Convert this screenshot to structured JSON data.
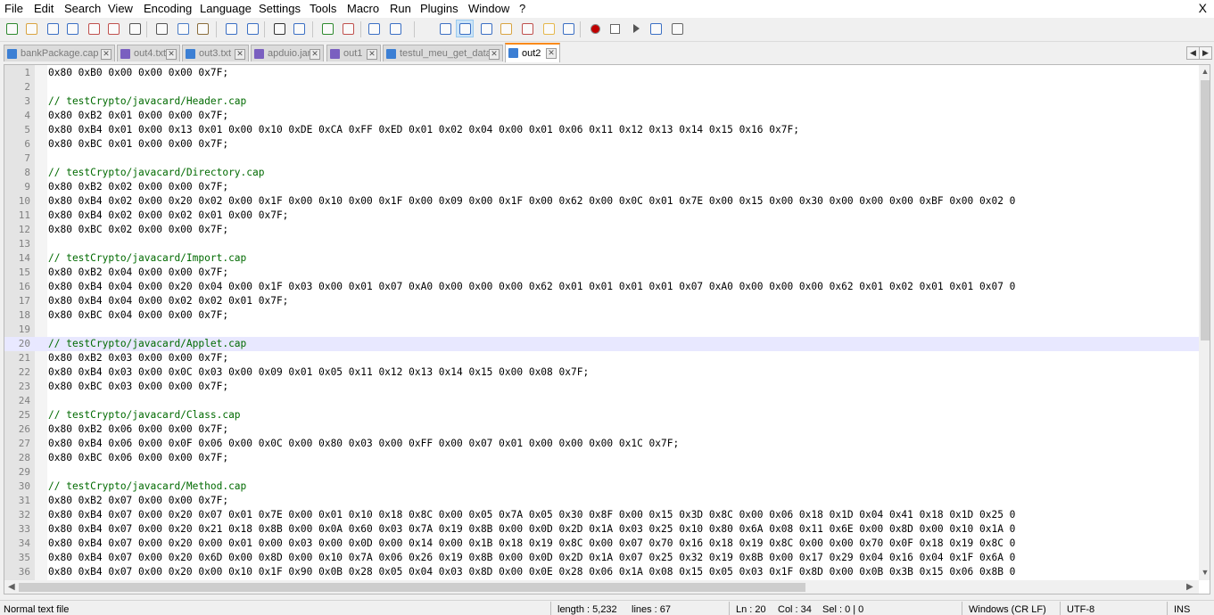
{
  "menu": [
    "File",
    "Edit",
    "Search",
    "View",
    "Encoding",
    "Language",
    "Settings",
    "Tools",
    "Macro",
    "Run",
    "Plugins",
    "Window",
    "?"
  ],
  "close_label": "X",
  "toolbar_icons": [
    "new-file-icon",
    "open-file-icon",
    "save-icon",
    "save-all-icon",
    "close-icon",
    "close-all-icon",
    "print-icon",
    "cut-icon",
    "copy-icon",
    "paste-icon",
    "undo-icon",
    "redo-icon",
    "find-icon",
    "replace-icon",
    "zoom-in-icon",
    "zoom-out-icon",
    "sync-vertical-icon",
    "sync-horizontal-icon",
    "word-wrap-icon",
    "show-all-chars-icon",
    "indent-guide-icon",
    "document-map-icon",
    "function-list-icon",
    "folder-workspace-icon",
    "monitoring-icon",
    "record-macro-icon",
    "stop-macro-icon",
    "play-macro-icon",
    "run-macro-multiple-icon",
    "save-macro-icon"
  ],
  "tabs": [
    {
      "label": "bankPackage.cap",
      "active": false,
      "modified": false
    },
    {
      "label": "out4.txt",
      "active": false,
      "modified": true
    },
    {
      "label": "out3.txt",
      "active": false,
      "modified": false
    },
    {
      "label": "apduio.jar",
      "active": false,
      "modified": true
    },
    {
      "label": "out1",
      "active": false,
      "modified": true
    },
    {
      "label": "testul_meu_get_data",
      "active": false,
      "modified": false
    },
    {
      "label": "out2",
      "active": true,
      "modified": false
    }
  ],
  "editor": {
    "current_line": 20,
    "lines": [
      "0x80 0xB0 0x00 0x00 0x00 0x7F;",
      "",
      "// testCrypto/javacard/Header.cap",
      "0x80 0xB2 0x01 0x00 0x00 0x7F;",
      "0x80 0xB4 0x01 0x00 0x13 0x01 0x00 0x10 0xDE 0xCA 0xFF 0xED 0x01 0x02 0x04 0x00 0x01 0x06 0x11 0x12 0x13 0x14 0x15 0x16 0x7F;",
      "0x80 0xBC 0x01 0x00 0x00 0x7F;",
      "",
      "// testCrypto/javacard/Directory.cap",
      "0x80 0xB2 0x02 0x00 0x00 0x7F;",
      "0x80 0xB4 0x02 0x00 0x20 0x02 0x00 0x1F 0x00 0x10 0x00 0x1F 0x00 0x09 0x00 0x1F 0x00 0x62 0x00 0x0C 0x01 0x7E 0x00 0x15 0x00 0x30 0x00 0x00 0x00 0xBF 0x00 0x02 0",
      "0x80 0xB4 0x02 0x00 0x02 0x01 0x00 0x7F;",
      "0x80 0xBC 0x02 0x00 0x00 0x7F;",
      "",
      "// testCrypto/javacard/Import.cap",
      "0x80 0xB2 0x04 0x00 0x00 0x7F;",
      "0x80 0xB4 0x04 0x00 0x20 0x04 0x00 0x1F 0x03 0x00 0x01 0x07 0xA0 0x00 0x00 0x00 0x62 0x01 0x01 0x01 0x01 0x07 0xA0 0x00 0x00 0x00 0x62 0x01 0x02 0x01 0x01 0x07 0",
      "0x80 0xB4 0x04 0x00 0x02 0x02 0x01 0x7F;",
      "0x80 0xBC 0x04 0x00 0x00 0x7F;",
      "",
      "// testCrypto/javacard/Applet.cap",
      "0x80 0xB2 0x03 0x00 0x00 0x7F;",
      "0x80 0xB4 0x03 0x00 0x0C 0x03 0x00 0x09 0x01 0x05 0x11 0x12 0x13 0x14 0x15 0x00 0x08 0x7F;",
      "0x80 0xBC 0x03 0x00 0x00 0x7F;",
      "",
      "// testCrypto/javacard/Class.cap",
      "0x80 0xB2 0x06 0x00 0x00 0x7F;",
      "0x80 0xB4 0x06 0x00 0x0F 0x06 0x00 0x0C 0x00 0x80 0x03 0x00 0xFF 0x00 0x07 0x01 0x00 0x00 0x00 0x1C 0x7F;",
      "0x80 0xBC 0x06 0x00 0x00 0x7F;",
      "",
      "// testCrypto/javacard/Method.cap",
      "0x80 0xB2 0x07 0x00 0x00 0x7F;",
      "0x80 0xB4 0x07 0x00 0x20 0x07 0x01 0x7E 0x00 0x01 0x10 0x18 0x8C 0x00 0x05 0x7A 0x05 0x30 0x8F 0x00 0x15 0x3D 0x8C 0x00 0x06 0x18 0x1D 0x04 0x41 0x18 0x1D 0x25 0",
      "0x80 0xB4 0x07 0x00 0x20 0x21 0x18 0x8B 0x00 0x0A 0x60 0x03 0x7A 0x19 0x8B 0x00 0x0D 0x2D 0x1A 0x03 0x25 0x10 0x80 0x6A 0x08 0x11 0x6E 0x00 0x8D 0x00 0x10 0x1A 0",
      "0x80 0xB4 0x07 0x00 0x20 0x00 0x01 0x00 0x03 0x00 0x0D 0x00 0x14 0x00 0x1B 0x18 0x19 0x8C 0x00 0x07 0x70 0x16 0x18 0x19 0x8C 0x00 0x00 0x70 0x0F 0x18 0x19 0x8C 0",
      "0x80 0xB4 0x07 0x00 0x20 0x6D 0x00 0x8D 0x00 0x10 0x7A 0x06 0x26 0x19 0x8B 0x00 0x0D 0x2D 0x1A 0x07 0x25 0x32 0x19 0x8B 0x00 0x17 0x29 0x04 0x16 0x04 0x1F 0x6A 0",
      "0x80 0xB4 0x07 0x00 0x20 0x00 0x10 0x1F 0x90 0x0B 0x28 0x05 0x04 0x03 0x8D 0x00 0x0E 0x28 0x06 0x1A 0x08 0x15 0x05 0x03 0x1F 0x8D 0x00 0x0B 0x3B 0x15 0x06 0x8B 0"
    ]
  },
  "status": {
    "file_type": "Normal text file",
    "length": "length : 5,232",
    "lines": "lines : 67",
    "ln": "Ln : 20",
    "col": "Col : 34",
    "sel": "Sel : 0 | 0",
    "eol": "Windows (CR LF)",
    "encoding": "UTF-8",
    "mode": "INS"
  }
}
